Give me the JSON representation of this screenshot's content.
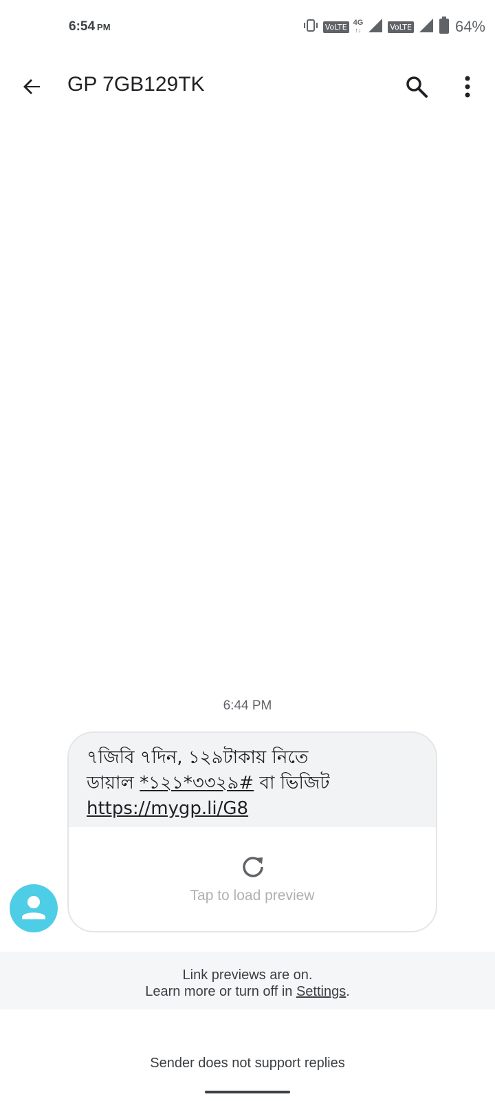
{
  "status_bar": {
    "time": "6:54",
    "ampm": "PM",
    "volte1": "VoLTE",
    "net_type": "4G",
    "volte2": "VoLTE",
    "battery_percent": "64%",
    "icons": [
      "vibrate-icon",
      "signal-icon",
      "battery-icon"
    ]
  },
  "app_bar": {
    "title": "GP 7GB129TK",
    "icons": [
      "back-arrow-icon",
      "search-icon",
      "more-vert-icon"
    ]
  },
  "conversation": {
    "timestamp": "6:44 PM",
    "message": {
      "line1": "৭জিবি ৭দিন, ১২৯টাকায় নিতে",
      "line2_prefix": "ডায়াল ",
      "ussd_code": "*১২১*৩৩২৯#",
      "line2_suffix": " বা ভিজিট",
      "url": "https://mygp.li/G8"
    },
    "preview": {
      "label": "Tap to load preview",
      "icon": "refresh-icon"
    },
    "avatar_icon": "person-icon"
  },
  "link_banner": {
    "line1": "Link previews are on.",
    "line2_prefix": "Learn more or turn off in ",
    "settings_link": "Settings",
    "line2_suffix": "."
  },
  "footer": {
    "no_reply": "Sender does not support replies"
  },
  "colors": {
    "avatar_bg": "#4ecde6",
    "bubble_bg": "#f1f3f4",
    "banner_bg": "#f5f6f8"
  }
}
